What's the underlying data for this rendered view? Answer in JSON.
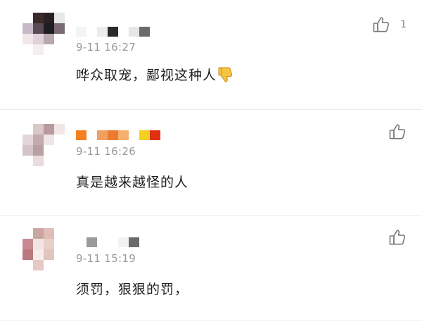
{
  "comments": [
    {
      "time": "9-11 16:27",
      "text": "哗众取宠，鄙视这种人",
      "like_count": "1",
      "like_icon": "thumbs-up-outline-icon",
      "emoji_icon": "thumbs-down-emoji-icon",
      "avatar_colors": [
        "#ffffff",
        "#3a2a2a",
        "#2a1f25",
        "#e8e8e8",
        "#c8b8c8",
        "#5a4a55",
        "#1e1e22",
        "#7a6a72",
        "#f0e8ea",
        "#e0d0d8",
        "#b8a8b0",
        "#ffffff",
        "#ffffff",
        "#f4eef0",
        "#ffffff",
        "#ffffff"
      ],
      "name_blocks": [
        "#f4f4f4",
        "#ffffff",
        "#ececec",
        "#2a2a2a",
        "#ffffff",
        "#e6e6e6",
        "#6a6a6a"
      ]
    },
    {
      "time": "9-11 16:26",
      "text": "真是越来越怪的人",
      "like_count": "",
      "like_icon": "thumbs-up-outline-icon",
      "avatar_colors": [
        "#ffffff",
        "#d8c8c8",
        "#b89a9e",
        "#f0e6e8",
        "#e4d6d8",
        "#c4aab0",
        "#efe4e6",
        "#ffffff",
        "#d4c4c8",
        "#b8a0a4",
        "#ffffff",
        "#ffffff",
        "#ffffff",
        "#e8dcde",
        "#ffffff",
        "#ffffff"
      ],
      "name_blocks": [
        "#f58220",
        "#ffffff",
        "#f0a060",
        "#ec7a30",
        "#f5b070",
        "#ffffff",
        "#f5d020",
        "#e03010"
      ]
    },
    {
      "time": "9-11 15:19",
      "text": "须罚，狠狠的罚，",
      "like_count": "",
      "like_icon": "thumbs-up-outline-icon",
      "avatar_colors": [
        "#ffffff",
        "#caa6a0",
        "#e2bcb6",
        "#ffffff",
        "#c88a90",
        "#f2e4e0",
        "#e8cfc8",
        "#ffffff",
        "#b8787e",
        "#f6ecea",
        "#e0c4c0",
        "#ffffff",
        "#ffffff",
        "#e6c8c4",
        "#ffffff",
        "#ffffff"
      ],
      "name_blocks": [
        "#ffffff",
        "#9a9a9a",
        "#ffffff",
        "#ffffff",
        "#f2f2f2",
        "#6a6a6a"
      ]
    }
  ]
}
